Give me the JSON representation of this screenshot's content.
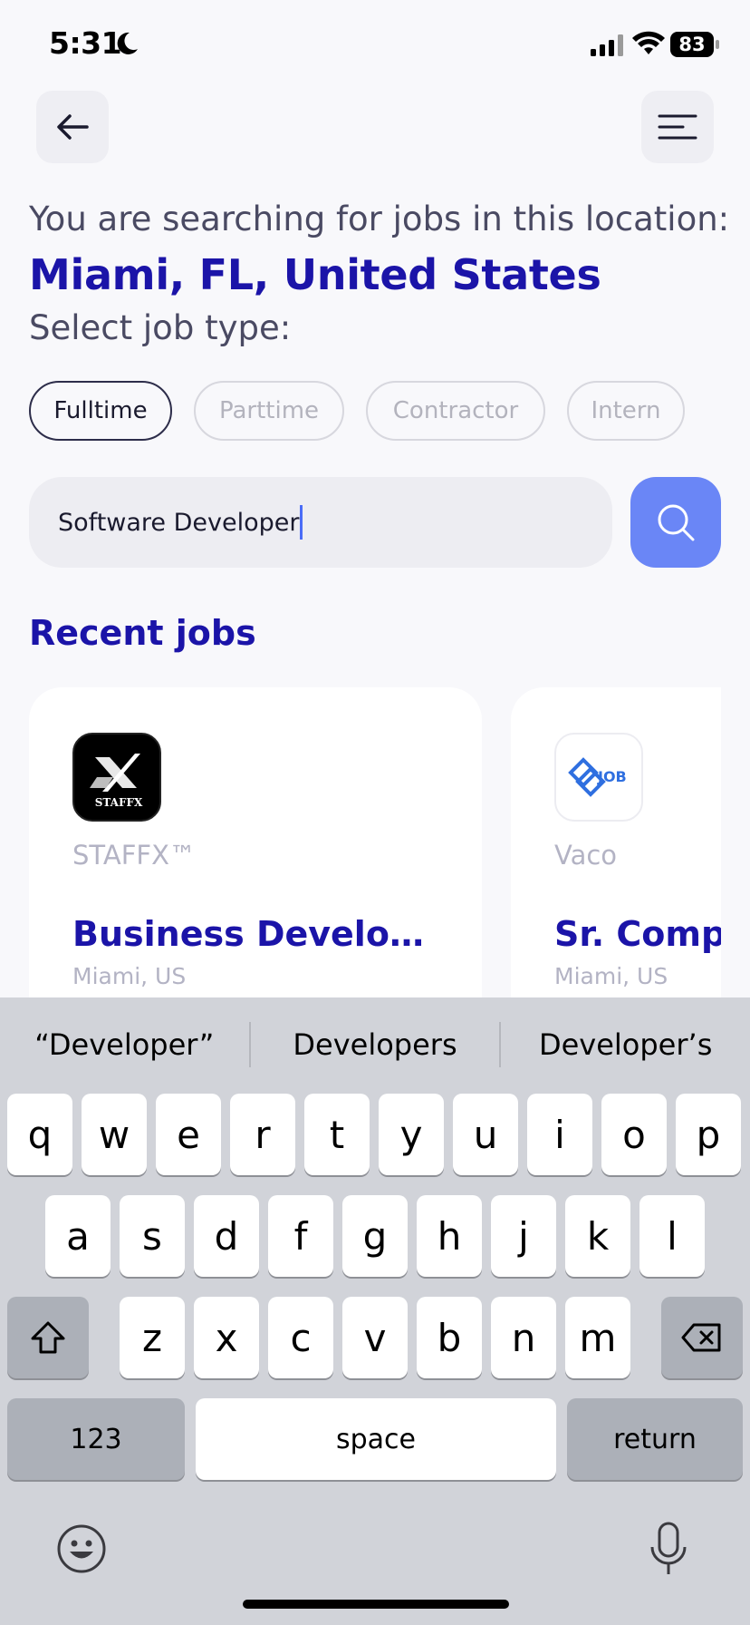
{
  "status": {
    "time": "5:31",
    "battery": "83"
  },
  "header": {
    "intro": "You are searching for jobs in this location:",
    "location": "Miami, FL, United States",
    "select_type": "Select job type:"
  },
  "job_types": [
    {
      "label": "Fulltime",
      "selected": true
    },
    {
      "label": "Parttime",
      "selected": false
    },
    {
      "label": "Contractor",
      "selected": false
    },
    {
      "label": "Intern",
      "selected": false
    }
  ],
  "search": {
    "value": "Software Developer"
  },
  "recent": {
    "title": "Recent jobs",
    "jobs": [
      {
        "company": "STAFFX™",
        "title": "Business Developm...",
        "location": "Miami, US",
        "logo": "staffx-logo"
      },
      {
        "company": "Vaco",
        "title": "Sr. Compli",
        "location": "Miami, US",
        "logo": "vaco-job-logo"
      }
    ]
  },
  "keyboard": {
    "suggestions": [
      "“Developer”",
      "Developers",
      "Developer’s"
    ],
    "row1": [
      "q",
      "w",
      "e",
      "r",
      "t",
      "y",
      "u",
      "i",
      "o",
      "p"
    ],
    "row2": [
      "a",
      "s",
      "d",
      "f",
      "g",
      "h",
      "j",
      "k",
      "l"
    ],
    "row3": [
      "z",
      "x",
      "c",
      "v",
      "b",
      "n",
      "m"
    ],
    "numbers_label": "123",
    "space_label": "space",
    "return_label": "return"
  },
  "colors": {
    "accent": "#1b14a8",
    "search_button": "#6a86f6",
    "background": "#f8f8fb"
  }
}
